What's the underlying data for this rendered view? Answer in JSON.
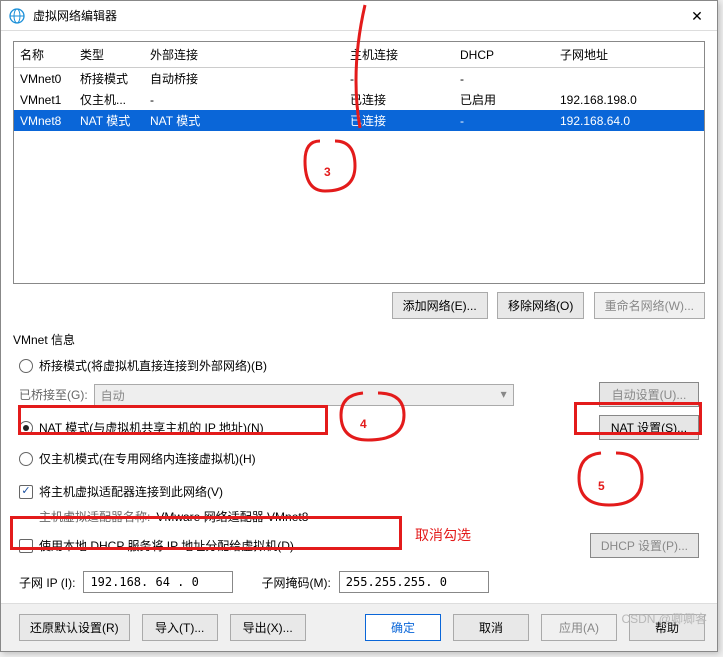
{
  "title": "虚拟网络编辑器",
  "table": {
    "headers": [
      "名称",
      "类型",
      "外部连接",
      "主机连接",
      "DHCP",
      "子网地址"
    ],
    "rows": [
      {
        "name": "VMnet0",
        "type": "桥接模式",
        "ext": "自动桥接",
        "host": "-",
        "dhcp": "-",
        "subnet": ""
      },
      {
        "name": "VMnet1",
        "type": "仅主机...",
        "ext": "-",
        "host": "已连接",
        "dhcp": "已启用",
        "subnet": "192.168.198.0"
      },
      {
        "name": "VMnet8",
        "type": "NAT 模式",
        "ext": "NAT 模式",
        "host": "已连接",
        "dhcp": "-",
        "subnet": "192.168.64.0"
      }
    ]
  },
  "btns": {
    "add": "添加网络(E)...",
    "remove": "移除网络(O)",
    "rename": "重命名网络(W)..."
  },
  "info": {
    "title": "VMnet 信息",
    "bridge": "桥接模式(将虚拟机直接连接到外部网络)(B)",
    "bridge_to": "已桥接至(G):",
    "bridge_auto": "自动",
    "auto_set": "自动设置(U)...",
    "nat": "NAT 模式(与虚拟机共享主机的 IP 地址)(N)",
    "nat_set": "NAT 设置(S)...",
    "hostonly": "仅主机模式(在专用网络内连接虚拟机)(H)",
    "connect_host": "将主机虚拟适配器连接到此网络(V)",
    "adapter_name_lbl": "主机虚拟适配器名称:",
    "adapter_name": "VMware 网络适配器 VMnet8",
    "dhcp": "使用本地 DHCP 服务将 IP 地址分配给虚拟机(D)",
    "dhcp_set": "DHCP 设置(P)...",
    "subnet_ip_lbl": "子网 IP (I):",
    "subnet_ip": "192.168. 64 . 0",
    "subnet_mask_lbl": "子网掩码(M):",
    "subnet_mask": "255.255.255. 0"
  },
  "footer": {
    "restore": "还原默认设置(R)",
    "import": "导入(T)...",
    "export": "导出(X)...",
    "ok": "确定",
    "cancel": "取消",
    "apply": "应用(A)",
    "help": "帮助"
  },
  "anno": {
    "n3": "3",
    "n4": "4",
    "n5": "5",
    "cancel": "取消勾选"
  },
  "watermark": "CSDN @卿卿客"
}
